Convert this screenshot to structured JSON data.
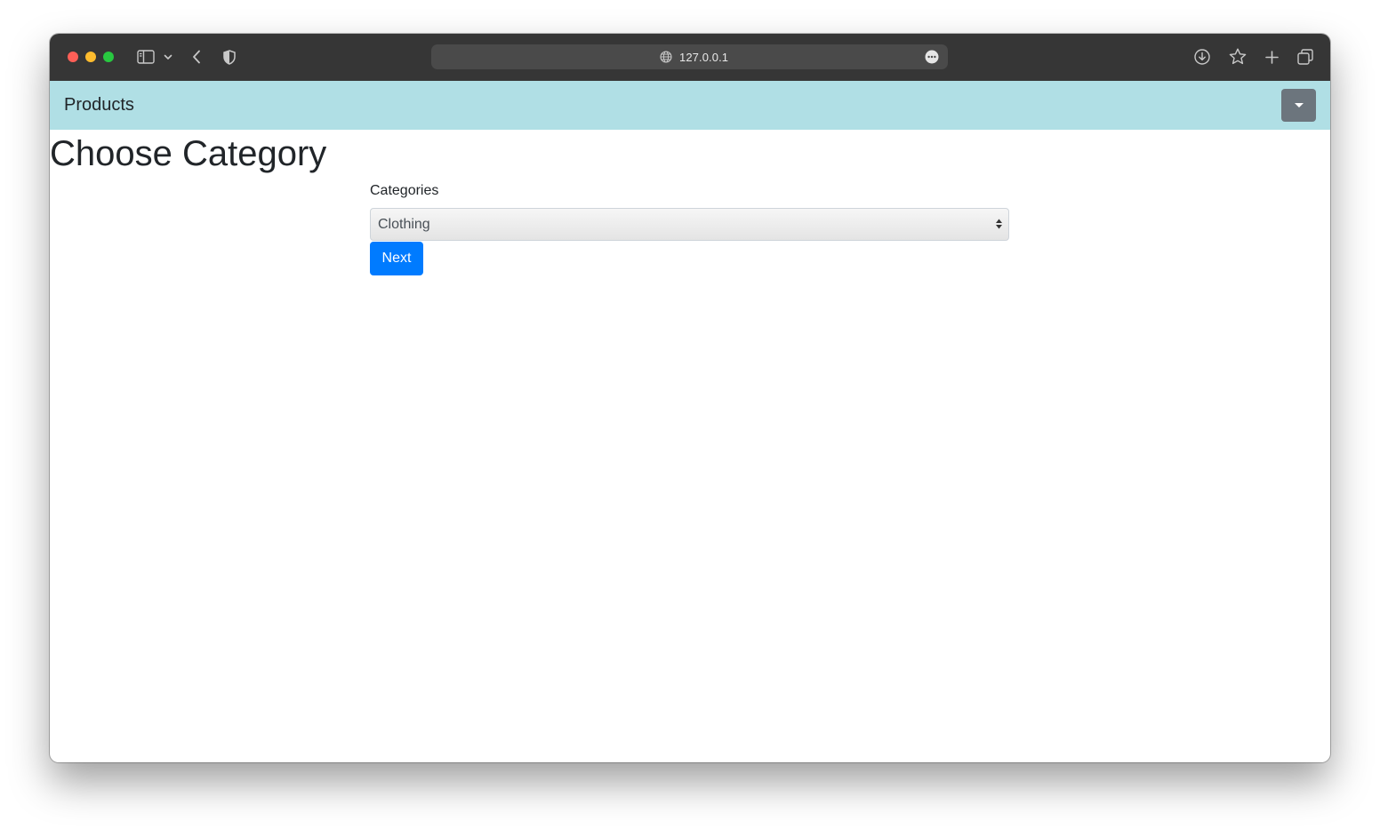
{
  "browser": {
    "url": "127.0.0.1",
    "icons": {
      "sidebar": "sidebar-icon",
      "chevron": "chevron-down-icon",
      "back": "back-arrow-icon",
      "shield": "shield-icon",
      "globe": "globe-icon",
      "more": "more-icon",
      "download": "download-icon",
      "bookmark": "star-icon",
      "new_tab": "plus-icon",
      "tabs": "tabs-overview-icon"
    },
    "traffic_lights": {
      "close": "#fe5f57",
      "minimize": "#febc2e",
      "zoom": "#28c840"
    }
  },
  "navbar": {
    "brand": "Products",
    "background": "#b0dfe5",
    "dropdown_color": "#6c757d"
  },
  "main": {
    "title": "Choose Category",
    "form": {
      "label": "Categories",
      "selected": "Clothing",
      "submit_label": "Next",
      "submit_color": "#007bff"
    }
  }
}
